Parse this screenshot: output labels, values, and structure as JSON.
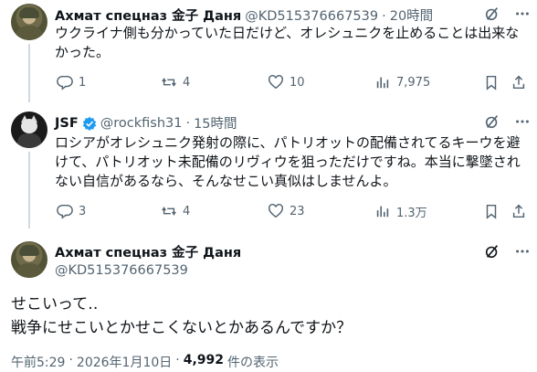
{
  "tweets": [
    {
      "display_name": "Ахмат спецназ 金子 Даня",
      "handle": "@KD515376667539",
      "sep": "·",
      "time": "20時間",
      "lines": [
        "ウクライナ側も分かっていた日だけど、オレシュニクを止めることは出来な",
        "かった。"
      ],
      "replies": "1",
      "reposts": "4",
      "likes": "10",
      "views": "7,975"
    },
    {
      "display_name": "JSF",
      "handle": "@rockfish31",
      "sep": "·",
      "time": "15時間",
      "lines": [
        "ロシアがオレシュニク発射の際に、パトリオットの配備されてるキーウを避",
        "けて、パトリオット未配備のリヴィウを狙っただけですね。本当に撃墜され",
        "ない自信があるなら、そんなせこい真似はしませんよ。"
      ],
      "replies": "3",
      "reposts": "4",
      "likes": "23",
      "views": "1.3万"
    }
  ],
  "main_tweet": {
    "display_name": "Ахмат спецназ 金子 Даня",
    "handle": "@KD515376667539",
    "lines": [
      "せこいって‥",
      "戦争にせこいとかせこくないとかあるんですか？"
    ],
    "time": "午前5:29",
    "sep": "·",
    "date": "2026年1月10日",
    "view_count": "4,992",
    "view_label": "件の表示"
  },
  "colors": {
    "verified": "#1d9bf0",
    "muted": "#536471",
    "text": "#0f1419"
  },
  "icons": [
    "reply-icon",
    "repost-icon",
    "like-icon",
    "views-icon",
    "bookmark-icon",
    "share-icon",
    "grok-icon",
    "more-icon",
    "verified-badge-icon"
  ]
}
